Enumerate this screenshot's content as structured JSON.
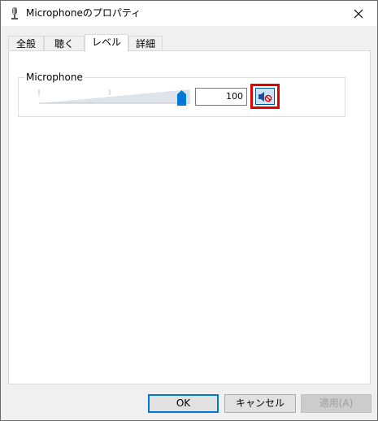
{
  "window": {
    "title": "Microphoneのプロパティ"
  },
  "tabs": [
    {
      "label": "全般"
    },
    {
      "label": "聴く"
    },
    {
      "label": "レベル"
    },
    {
      "label": "詳細"
    }
  ],
  "active_tab": "レベル",
  "level": {
    "group_label": "Microphone",
    "value": "100",
    "slider_level": 1.0,
    "mute_state": "muted"
  },
  "buttons": {
    "ok": "OK",
    "cancel": "キャンセル",
    "apply": "適用(A)"
  },
  "colors": {
    "highlight": "#e00000",
    "accent": "#0078d7"
  }
}
